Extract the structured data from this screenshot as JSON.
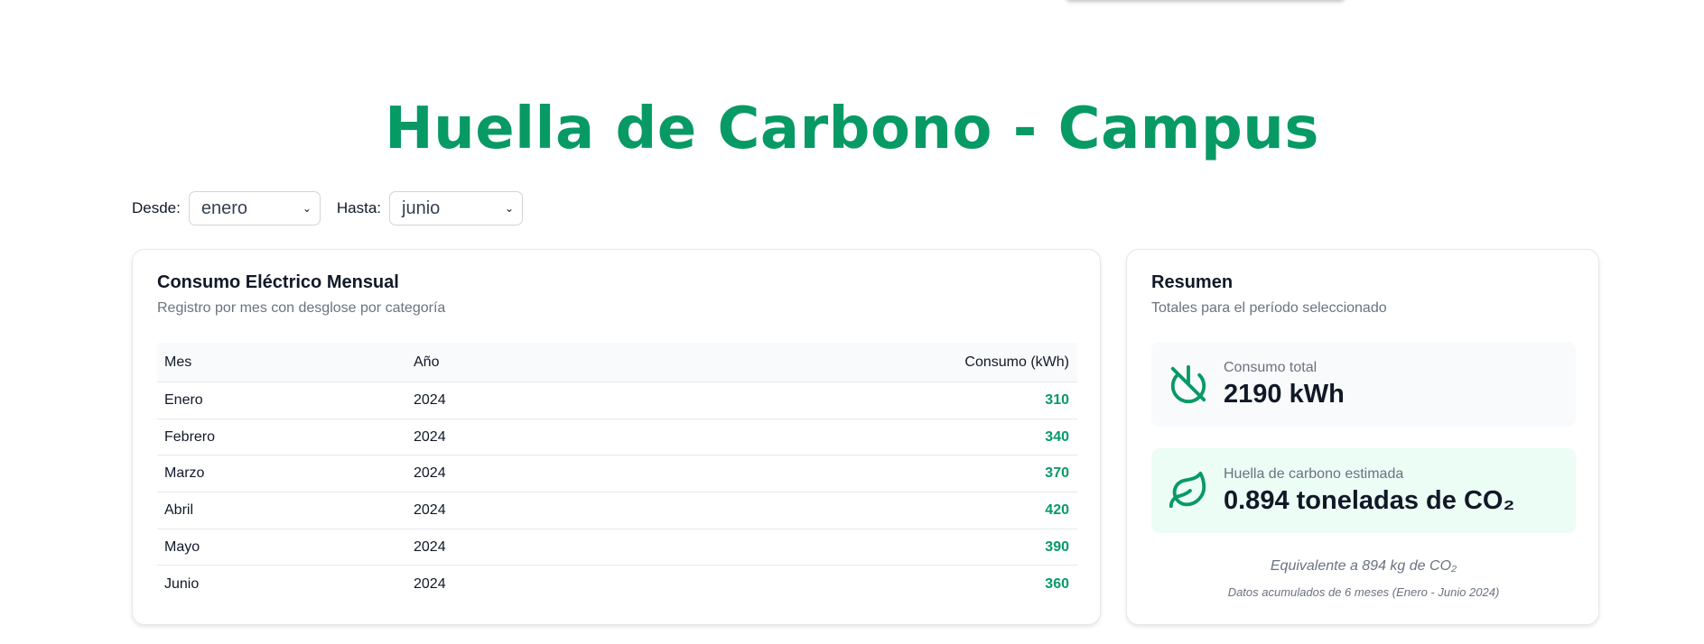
{
  "page": {
    "title": "Huella de Carbono - Campus",
    "accent_color": "#079a65"
  },
  "filters": {
    "desde_label": "Desde:",
    "desde_value": "enero",
    "hasta_label": "Hasta:",
    "hasta_value": "junio"
  },
  "consumo": {
    "title": "Consumo Eléctrico Mensual",
    "subtitle": "Registro por mes con desglose por categoría",
    "columns": [
      "Mes",
      "Año",
      "Consumo (kWh)"
    ],
    "rows": [
      {
        "mes": "Enero",
        "ano": "2024",
        "kwh": "310"
      },
      {
        "mes": "Febrero",
        "ano": "2024",
        "kwh": "340"
      },
      {
        "mes": "Marzo",
        "ano": "2024",
        "kwh": "370"
      },
      {
        "mes": "Abril",
        "ano": "2024",
        "kwh": "420"
      },
      {
        "mes": "Mayo",
        "ano": "2024",
        "kwh": "390"
      },
      {
        "mes": "Junio",
        "ano": "2024",
        "kwh": "360"
      }
    ]
  },
  "resumen": {
    "title": "Resumen",
    "subtitle": "Totales para el período seleccionado",
    "total_label": "Consumo total",
    "total_value": "2190 kWh",
    "total_icon": "no-power-icon",
    "co2_label": "Huella de carbono estimada",
    "co2_value": "0.894 toneladas de CO₂",
    "co2_icon": "leaf-icon",
    "equivalente": "Equivalente a 894 kg de CO₂",
    "acumulado": "Datos acumulados de 6 meses (Enero - Junio 2024)"
  }
}
